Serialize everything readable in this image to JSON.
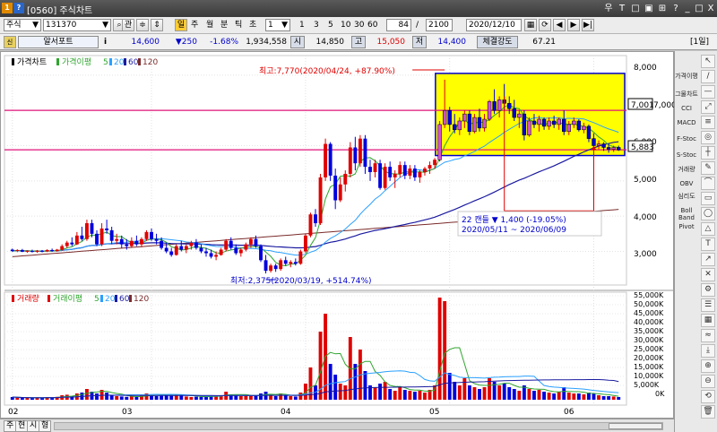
{
  "window": {
    "icon1": "1",
    "icon2": "?",
    "title": "[0560] 주식차트",
    "controls": [
      "우",
      "T",
      "□",
      "▣",
      "⊞",
      "?",
      "_",
      "□",
      "X"
    ]
  },
  "toolbar": {
    "market": "주식",
    "code": "131370",
    "gwan_label": "관",
    "day_label": "일",
    "week_label": "주",
    "month_label": "월",
    "min_label": "분",
    "tick_label": "틱",
    "sec_label": "초",
    "period_value": "1",
    "period_buttons": [
      "1",
      "3",
      "5",
      "10",
      "30",
      "60"
    ],
    "count_value": "84",
    "total_value": "2100",
    "date_value": "2020/12/10"
  },
  "quote": {
    "name": "알서포트",
    "info_icon": "i",
    "price": "14,600",
    "change": "▼250",
    "change_pct": "-1.68%",
    "volume": "1,934,558",
    "open_label": "시",
    "open": "14,850",
    "high_label": "고",
    "high": "15,050",
    "low_label": "저",
    "low": "14,400",
    "strength_label": "체결강도",
    "strength": "67.21",
    "period_tag": "[1일]"
  },
  "colors": {
    "up": "#e00000",
    "down": "#0000dd",
    "ma5": "#2fa52f",
    "ma20": "#2aa0ff",
    "ma60": "#1a1aa0",
    "ma120": "#7a2a2a",
    "highlight": "#ffff00",
    "hline": "#e0147a"
  },
  "price_panel": {
    "legend_title": "가격차트",
    "legend_ma": "가격이평",
    "ma_periods": [
      "5",
      "20",
      "60",
      "120"
    ],
    "high_annotation": "최고:7,770(2020/04/24, +87.90%)",
    "low_annotation": "최저:2,375(2020/03/19, +514.74%)",
    "range_line1": "22 캔들  ▼ 1,400 (-19.05%)",
    "range_line2": "2020/05/11 ~ 2020/06/09",
    "hline_upper": "7,001",
    "hline_lower": "5,883",
    "y_ticks": [
      "8,000",
      "7,000",
      "6,000",
      "5,000",
      "4,000",
      "3,000"
    ]
  },
  "volume_panel": {
    "legend_title": "거래량",
    "legend_ma": "거래이평",
    "ma_periods": [
      "5",
      "20",
      "60",
      "120"
    ],
    "y_ticks": [
      "55,000K",
      "50,000K",
      "45,000K",
      "40,000K",
      "35,000K",
      "30,000K",
      "25,000K",
      "20,000K",
      "15,000K",
      "10,000K",
      "5,000K",
      "0K"
    ]
  },
  "x_axis": {
    "month_labels": [
      "02",
      "03",
      "04",
      "05",
      "06"
    ]
  },
  "bottom_tabs": [
    "주",
    "현",
    "시",
    "형"
  ],
  "sidebar": {
    "items": [
      "가격이평",
      "그물차트",
      "CCI",
      "MACD",
      "F-Stoc",
      "S-Stoc",
      "거래량",
      "OBV",
      "심리도",
      "Boll Band",
      "Pivot"
    ],
    "tools": [
      "↖",
      "/",
      "—",
      "⤢",
      "≡",
      "◎",
      "┼",
      "✎",
      "⌒",
      "▭",
      "◯",
      "△",
      "T",
      "↗",
      "✕",
      "⚙",
      "☰",
      "▦",
      "≈",
      "⤓",
      "⊕",
      "⊖",
      "⟲",
      "🗑"
    ]
  },
  "chart_data": {
    "type": "candlestick",
    "price_unit": "KRW",
    "ylim_price": [
      2375,
      8250
    ],
    "ylim_volume": [
      0,
      58000
    ],
    "candles": [
      {
        "o": 3050,
        "h": 3080,
        "l": 2990,
        "c": 3010,
        "v": 1500
      },
      {
        "o": 3020,
        "h": 3060,
        "l": 2980,
        "c": 3040,
        "v": 1200
      },
      {
        "o": 3040,
        "h": 3070,
        "l": 2980,
        "c": 2990,
        "v": 1000
      },
      {
        "o": 2990,
        "h": 3030,
        "l": 2960,
        "c": 3020,
        "v": 1100
      },
      {
        "o": 3010,
        "h": 3050,
        "l": 2970,
        "c": 2990,
        "v": 900
      },
      {
        "o": 2990,
        "h": 3040,
        "l": 2960,
        "c": 3020,
        "v": 1300
      },
      {
        "o": 3020,
        "h": 3040,
        "l": 2970,
        "c": 2990,
        "v": 1000
      },
      {
        "o": 3000,
        "h": 3060,
        "l": 2980,
        "c": 3040,
        "v": 1400
      },
      {
        "o": 3040,
        "h": 3080,
        "l": 2990,
        "c": 3010,
        "v": 1200
      },
      {
        "o": 3010,
        "h": 3070,
        "l": 2990,
        "c": 3050,
        "v": 1600
      },
      {
        "o": 3050,
        "h": 3200,
        "l": 3020,
        "c": 3150,
        "v": 2500
      },
      {
        "o": 3150,
        "h": 3300,
        "l": 3100,
        "c": 3250,
        "v": 2800
      },
      {
        "o": 3250,
        "h": 3400,
        "l": 3150,
        "c": 3200,
        "v": 2000
      },
      {
        "o": 3200,
        "h": 3550,
        "l": 3180,
        "c": 3450,
        "v": 3500
      },
      {
        "o": 3450,
        "h": 3700,
        "l": 3300,
        "c": 3350,
        "v": 4000
      },
      {
        "o": 3350,
        "h": 3900,
        "l": 3300,
        "c": 3800,
        "v": 6000
      },
      {
        "o": 3800,
        "h": 3900,
        "l": 3400,
        "c": 3500,
        "v": 4500
      },
      {
        "o": 3500,
        "h": 3600,
        "l": 3150,
        "c": 3200,
        "v": 3500
      },
      {
        "o": 3200,
        "h": 3800,
        "l": 3150,
        "c": 3650,
        "v": 5500
      },
      {
        "o": 3650,
        "h": 3900,
        "l": 3500,
        "c": 3600,
        "v": 4000
      },
      {
        "o": 3600,
        "h": 3700,
        "l": 3200,
        "c": 3300,
        "v": 2500
      },
      {
        "o": 3300,
        "h": 3500,
        "l": 3200,
        "c": 3350,
        "v": 2000
      },
      {
        "o": 3350,
        "h": 3450,
        "l": 3100,
        "c": 3200,
        "v": 1800
      },
      {
        "o": 3200,
        "h": 3350,
        "l": 3050,
        "c": 3150,
        "v": 1600
      },
      {
        "o": 3150,
        "h": 3400,
        "l": 3100,
        "c": 3300,
        "v": 1900
      },
      {
        "o": 3300,
        "h": 3450,
        "l": 3150,
        "c": 3200,
        "v": 1500
      },
      {
        "o": 3200,
        "h": 3400,
        "l": 3120,
        "c": 3350,
        "v": 2200
      },
      {
        "o": 3350,
        "h": 3600,
        "l": 3300,
        "c": 3550,
        "v": 3500
      },
      {
        "o": 3550,
        "h": 3650,
        "l": 3300,
        "c": 3350,
        "v": 2500
      },
      {
        "o": 3350,
        "h": 3500,
        "l": 3200,
        "c": 3300,
        "v": 2000
      },
      {
        "o": 3300,
        "h": 3400,
        "l": 3050,
        "c": 3100,
        "v": 2200
      },
      {
        "o": 3100,
        "h": 3250,
        "l": 2950,
        "c": 3000,
        "v": 2400
      },
      {
        "o": 3000,
        "h": 3100,
        "l": 2850,
        "c": 2900,
        "v": 2600
      },
      {
        "o": 2900,
        "h": 3200,
        "l": 2880,
        "c": 3150,
        "v": 3000
      },
      {
        "o": 3150,
        "h": 3300,
        "l": 3000,
        "c": 3050,
        "v": 2500
      },
      {
        "o": 3050,
        "h": 3200,
        "l": 2950,
        "c": 3150,
        "v": 1800
      },
      {
        "o": 3150,
        "h": 3300,
        "l": 3050,
        "c": 3250,
        "v": 1500
      },
      {
        "o": 3250,
        "h": 3350,
        "l": 3050,
        "c": 3100,
        "v": 1700
      },
      {
        "o": 3100,
        "h": 3200,
        "l": 2950,
        "c": 3000,
        "v": 1600
      },
      {
        "o": 3000,
        "h": 3100,
        "l": 2850,
        "c": 2950,
        "v": 1900
      },
      {
        "o": 2950,
        "h": 3050,
        "l": 2800,
        "c": 2850,
        "v": 2200
      },
      {
        "o": 2850,
        "h": 3000,
        "l": 2750,
        "c": 2900,
        "v": 2000
      },
      {
        "o": 2900,
        "h": 3100,
        "l": 2880,
        "c": 3050,
        "v": 2300
      },
      {
        "o": 3050,
        "h": 3350,
        "l": 3000,
        "c": 3300,
        "v": 4500
      },
      {
        "o": 3300,
        "h": 3400,
        "l": 3050,
        "c": 3100,
        "v": 3000
      },
      {
        "o": 3100,
        "h": 3200,
        "l": 2900,
        "c": 2950,
        "v": 2500
      },
      {
        "o": 2950,
        "h": 3100,
        "l": 2850,
        "c": 3050,
        "v": 2000
      },
      {
        "o": 3050,
        "h": 3250,
        "l": 3000,
        "c": 3200,
        "v": 2200
      },
      {
        "o": 3200,
        "h": 3400,
        "l": 3100,
        "c": 3350,
        "v": 2500
      },
      {
        "o": 3350,
        "h": 3450,
        "l": 3100,
        "c": 3150,
        "v": 2300
      },
      {
        "o": 3150,
        "h": 3200,
        "l": 2700,
        "c": 2750,
        "v": 3500
      },
      {
        "o": 2750,
        "h": 2900,
        "l": 2375,
        "c": 2450,
        "v": 4500
      },
      {
        "o": 2450,
        "h": 2650,
        "l": 2400,
        "c": 2600,
        "v": 2500
      },
      {
        "o": 2600,
        "h": 2650,
        "l": 2420,
        "c": 2500,
        "v": 2000
      },
      {
        "o": 2500,
        "h": 2800,
        "l": 2450,
        "c": 2750,
        "v": 3500
      },
      {
        "o": 2750,
        "h": 2850,
        "l": 2600,
        "c": 2650,
        "v": 2500
      },
      {
        "o": 2650,
        "h": 2750,
        "l": 2550,
        "c": 2700,
        "v": 2000
      },
      {
        "o": 2700,
        "h": 2800,
        "l": 2600,
        "c": 2650,
        "v": 1800
      },
      {
        "o": 2650,
        "h": 3050,
        "l": 2620,
        "c": 3000,
        "v": 4000
      },
      {
        "o": 3000,
        "h": 3500,
        "l": 2950,
        "c": 3450,
        "v": 9000
      },
      {
        "o": 3450,
        "h": 4100,
        "l": 3400,
        "c": 4050,
        "v": 18000
      },
      {
        "o": 4050,
        "h": 4200,
        "l": 3700,
        "c": 3800,
        "v": 8000
      },
      {
        "o": 3800,
        "h": 5200,
        "l": 3750,
        "c": 5100,
        "v": 38000
      },
      {
        "o": 5100,
        "h": 6200,
        "l": 5000,
        "c": 6050,
        "v": 48000
      },
      {
        "o": 6050,
        "h": 6100,
        "l": 5000,
        "c": 5150,
        "v": 20000
      },
      {
        "o": 5150,
        "h": 5350,
        "l": 4200,
        "c": 4450,
        "v": 14000
      },
      {
        "o": 4450,
        "h": 5100,
        "l": 4400,
        "c": 4900,
        "v": 9000
      },
      {
        "o": 4900,
        "h": 5300,
        "l": 4700,
        "c": 5200,
        "v": 8000
      },
      {
        "o": 5200,
        "h": 6100,
        "l": 5100,
        "c": 5950,
        "v": 35000
      },
      {
        "o": 5950,
        "h": 6250,
        "l": 5300,
        "c": 5500,
        "v": 20000
      },
      {
        "o": 5500,
        "h": 6300,
        "l": 5400,
        "c": 6200,
        "v": 28000
      },
      {
        "o": 6200,
        "h": 6300,
        "l": 5200,
        "c": 5400,
        "v": 16000
      },
      {
        "o": 5400,
        "h": 5600,
        "l": 5000,
        "c": 5250,
        "v": 8000
      },
      {
        "o": 5250,
        "h": 5600,
        "l": 5100,
        "c": 5500,
        "v": 7000
      },
      {
        "o": 5500,
        "h": 5600,
        "l": 4750,
        "c": 4800,
        "v": 9000
      },
      {
        "o": 4800,
        "h": 5500,
        "l": 4750,
        "c": 5400,
        "v": 10000
      },
      {
        "o": 5400,
        "h": 5550,
        "l": 5000,
        "c": 5100,
        "v": 6000
      },
      {
        "o": 5100,
        "h": 5300,
        "l": 4800,
        "c": 5200,
        "v": 5000
      },
      {
        "o": 5200,
        "h": 5550,
        "l": 5100,
        "c": 5450,
        "v": 7000
      },
      {
        "o": 5450,
        "h": 5550,
        "l": 5050,
        "c": 5150,
        "v": 5500
      },
      {
        "o": 5150,
        "h": 5450,
        "l": 5050,
        "c": 5350,
        "v": 5000
      },
      {
        "o": 5350,
        "h": 5450,
        "l": 5000,
        "c": 5100,
        "v": 4500
      },
      {
        "o": 5100,
        "h": 5300,
        "l": 4950,
        "c": 5250,
        "v": 5000
      },
      {
        "o": 5250,
        "h": 5400,
        "l": 5150,
        "c": 5350,
        "v": 4000
      },
      {
        "o": 5350,
        "h": 5550,
        "l": 5200,
        "c": 5450,
        "v": 5500
      },
      {
        "o": 5450,
        "h": 5650,
        "l": 5350,
        "c": 5600,
        "v": 8000
      },
      {
        "o": 5600,
        "h": 6700,
        "l": 5550,
        "c": 6600,
        "v": 57000
      },
      {
        "o": 6600,
        "h": 7770,
        "l": 6500,
        "c": 7000,
        "v": 55000
      },
      {
        "o": 7000,
        "h": 7100,
        "l": 6400,
        "c": 6600,
        "v": 15000
      },
      {
        "o": 6600,
        "h": 6900,
        "l": 6350,
        "c": 6450,
        "v": 10000
      },
      {
        "o": 6450,
        "h": 6800,
        "l": 6300,
        "c": 6700,
        "v": 8000
      },
      {
        "o": 6700,
        "h": 7000,
        "l": 6500,
        "c": 6900,
        "v": 12000
      },
      {
        "o": 6900,
        "h": 7000,
        "l": 6300,
        "c": 6400,
        "v": 8000
      },
      {
        "o": 6400,
        "h": 6900,
        "l": 6350,
        "c": 6800,
        "v": 7000
      },
      {
        "o": 6800,
        "h": 7050,
        "l": 6400,
        "c": 6500,
        "v": 6000
      },
      {
        "o": 6500,
        "h": 6900,
        "l": 6400,
        "c": 6750,
        "v": 7000
      },
      {
        "o": 6750,
        "h": 7300,
        "l": 6700,
        "c": 7250,
        "v": 12000
      },
      {
        "o": 7250,
        "h": 7600,
        "l": 6900,
        "c": 7000,
        "v": 10000
      },
      {
        "o": 7000,
        "h": 7400,
        "l": 6800,
        "c": 7300,
        "v": 8000
      },
      {
        "o": 7300,
        "h": 7750,
        "l": 7000,
        "c": 7200,
        "v": 9000
      },
      {
        "o": 7200,
        "h": 7400,
        "l": 6900,
        "c": 7050,
        "v": 7000
      },
      {
        "o": 7050,
        "h": 7300,
        "l": 6700,
        "c": 6800,
        "v": 6000
      },
      {
        "o": 6800,
        "h": 7000,
        "l": 6500,
        "c": 6900,
        "v": 5000
      },
      {
        "o": 6900,
        "h": 7000,
        "l": 6150,
        "c": 6300,
        "v": 8000
      },
      {
        "o": 6300,
        "h": 6800,
        "l": 6250,
        "c": 6700,
        "v": 6000
      },
      {
        "o": 6700,
        "h": 6900,
        "l": 6500,
        "c": 6600,
        "v": 5000
      },
      {
        "o": 6600,
        "h": 6850,
        "l": 6400,
        "c": 6750,
        "v": 5500
      },
      {
        "o": 6750,
        "h": 6800,
        "l": 6450,
        "c": 6550,
        "v": 4500
      },
      {
        "o": 6550,
        "h": 6800,
        "l": 6450,
        "c": 6700,
        "v": 4000
      },
      {
        "o": 6700,
        "h": 6850,
        "l": 6500,
        "c": 6600,
        "v": 3500
      },
      {
        "o": 6600,
        "h": 6800,
        "l": 6450,
        "c": 6750,
        "v": 4500
      },
      {
        "o": 6750,
        "h": 7000,
        "l": 6300,
        "c": 6400,
        "v": 7000
      },
      {
        "o": 6400,
        "h": 6700,
        "l": 6300,
        "c": 6600,
        "v": 4000
      },
      {
        "o": 6600,
        "h": 6800,
        "l": 6500,
        "c": 6700,
        "v": 3500
      },
      {
        "o": 6700,
        "h": 6750,
        "l": 6400,
        "c": 6450,
        "v": 3500
      },
      {
        "o": 6450,
        "h": 6650,
        "l": 6350,
        "c": 6550,
        "v": 3000
      },
      {
        "o": 6550,
        "h": 6600,
        "l": 6100,
        "c": 6200,
        "v": 4000
      },
      {
        "o": 6200,
        "h": 6350,
        "l": 5950,
        "c": 6000,
        "v": 3500
      },
      {
        "o": 6000,
        "h": 6150,
        "l": 5900,
        "c": 6050,
        "v": 2500
      },
      {
        "o": 6050,
        "h": 6100,
        "l": 5850,
        "c": 5950,
        "v": 2000
      },
      {
        "o": 5950,
        "h": 6050,
        "l": 5800,
        "c": 5900,
        "v": 2000
      },
      {
        "o": 5900,
        "h": 6000,
        "l": 5820,
        "c": 5950,
        "v": 1800
      },
      {
        "o": 5950,
        "h": 6000,
        "l": 5850,
        "c": 5880,
        "v": 1500
      }
    ]
  }
}
